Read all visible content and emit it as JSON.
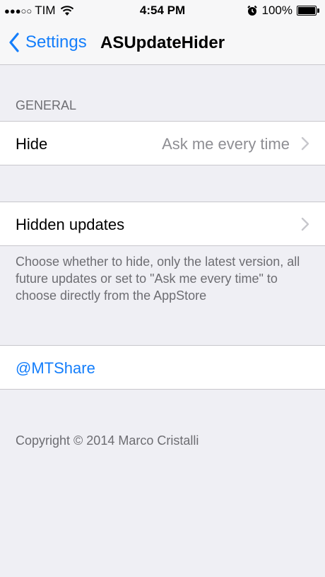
{
  "status_bar": {
    "signal": "●●●○○",
    "carrier": "TIM",
    "time": "4:54 PM",
    "battery": "100%"
  },
  "nav": {
    "back_label": "Settings",
    "title": "ASUpdateHider"
  },
  "general": {
    "header": "GENERAL",
    "hide_label": "Hide",
    "hide_value": "Ask me every time"
  },
  "hidden": {
    "label": "Hidden updates",
    "footer": "Choose whether to hide, only the latest version, all future updates or set to \"Ask me every time\" to choose directly from the AppStore"
  },
  "links": {
    "mtshare": "@MTShare"
  },
  "copyright": "Copyright © 2014 Marco Cristalli",
  "colors": {
    "accent": "#147efb",
    "background": "#efeff4",
    "secondary_text": "#8e8e93"
  }
}
